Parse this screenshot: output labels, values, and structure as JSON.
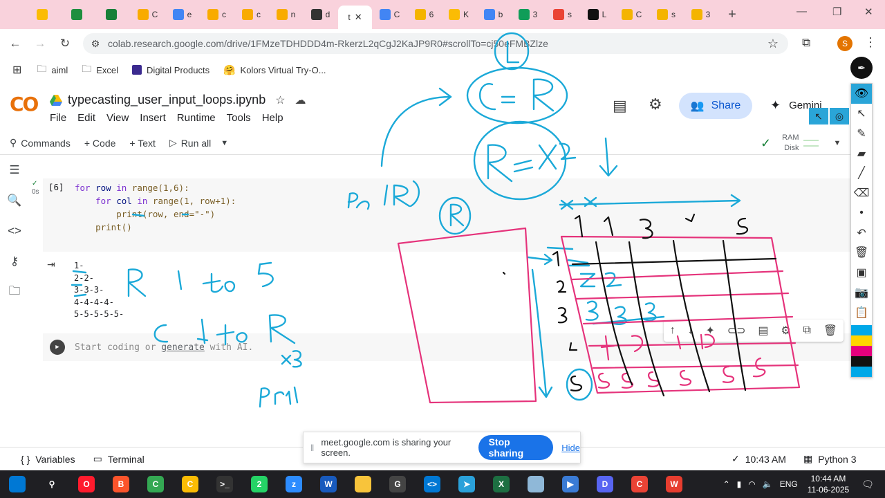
{
  "browser": {
    "tabs": [
      {
        "label": "",
        "icon": "emoji-icon",
        "color": "#fbbc04"
      },
      {
        "label": "",
        "icon": "classroom-icon",
        "color": "#1e8e3e"
      },
      {
        "label": "",
        "icon": "sheets-icon",
        "color": "#188038"
      },
      {
        "label": "C",
        "icon": "colab-icon",
        "color": "#f9ab00"
      },
      {
        "label": "e",
        "icon": "drive-icon",
        "color": "#4285f4"
      },
      {
        "label": "c",
        "icon": "colab-icon",
        "color": "#f9ab00"
      },
      {
        "label": "c",
        "icon": "colab-icon",
        "color": "#f9ab00"
      },
      {
        "label": "n",
        "icon": "colab-icon",
        "color": "#f9ab00"
      },
      {
        "label": "d",
        "icon": "github-icon",
        "color": "#333333"
      },
      {
        "label": "t",
        "icon": "none",
        "color": "#ffffff",
        "active": true
      },
      {
        "label": "C",
        "icon": "drive-icon",
        "color": "#4285f4"
      },
      {
        "label": "6",
        "icon": "slides-icon",
        "color": "#f4b400"
      },
      {
        "label": "K",
        "icon": "emoji-icon",
        "color": "#fbbc04"
      },
      {
        "label": "b",
        "icon": "google-icon",
        "color": "#4285f4"
      },
      {
        "label": "3",
        "icon": "notion-icon",
        "color": "#0f9d58"
      },
      {
        "label": "s",
        "icon": "google-icon",
        "color": "#ea4335"
      },
      {
        "label": "L",
        "icon": "openai-icon",
        "color": "#111111"
      },
      {
        "label": "C",
        "icon": "slides-icon",
        "color": "#f4b400"
      },
      {
        "label": "s",
        "icon": "slides-icon",
        "color": "#f4b400"
      },
      {
        "label": "3",
        "icon": "slides-icon",
        "color": "#f4b400"
      }
    ],
    "url": "colab.research.google.com/drive/1FMzeTDHDDD4m-RkerzL2qCgJ2KaJP9R0#scrollTo=cj50eFMBZlze",
    "profile_initial": "S",
    "bookmarks": [
      {
        "label": "aiml",
        "icon": "folder-icon"
      },
      {
        "label": "Excel",
        "icon": "folder-icon"
      },
      {
        "label": "Digital Products",
        "icon": "bookmark-icon"
      },
      {
        "label": "Kolors Virtual Try-O...",
        "icon": "hf-icon"
      }
    ]
  },
  "colab": {
    "logo": "CO",
    "filename": "typecasting_user_input_loops.ipynb",
    "menu": [
      "File",
      "Edit",
      "View",
      "Insert",
      "Runtime",
      "Tools",
      "Help"
    ],
    "share_label": "Share",
    "gemini_label": "Gemini",
    "toolbar": {
      "commands": "Commands",
      "code": "+ Code",
      "text": "+ Text",
      "run_all": "Run all",
      "ram": "RAM",
      "disk": "Disk"
    },
    "cell": {
      "exec_count": "[6]",
      "exec_time": "0s",
      "code": [
        [
          "for",
          " row ",
          "in",
          " range(1,6):"
        ],
        [
          "    for",
          " col ",
          "in",
          " range(1, row+1):"
        ],
        [
          "        print(row, end=\"-\")"
        ],
        [
          "    print()"
        ]
      ]
    },
    "output_lines": [
      "1-",
      "2-2-",
      "3-3-3-",
      "4-4-4-4-",
      "5-5-5-5-5-"
    ],
    "new_cell": {
      "prefix": "Start coding or ",
      "link": "generate",
      "suffix": " with AI."
    },
    "status": {
      "variables": "Variables",
      "terminal": "Terminal",
      "time": "10:43 AM",
      "python": "Python 3"
    }
  },
  "screen_share": {
    "message": "meet.google.com is sharing your screen.",
    "stop": "Stop sharing",
    "hide": "Hide"
  },
  "taskbar": {
    "apps": [
      {
        "name": "windows-start",
        "color": "#0078d4",
        "glyph": ""
      },
      {
        "name": "search",
        "color": "transparent",
        "glyph": "⚲"
      },
      {
        "name": "opera",
        "color": "#ff1b2d",
        "glyph": "O"
      },
      {
        "name": "brave",
        "color": "#fb542b",
        "glyph": "B"
      },
      {
        "name": "chrome-m",
        "color": "#34a853",
        "glyph": "C"
      },
      {
        "name": "chrome",
        "color": "#fbbc04",
        "glyph": "C"
      },
      {
        "name": "terminal",
        "color": "#333333",
        "glyph": ">_"
      },
      {
        "name": "whatsapp",
        "color": "#25d366",
        "glyph": "2"
      },
      {
        "name": "zoom",
        "color": "#2d8cff",
        "glyph": "z"
      },
      {
        "name": "word",
        "color": "#185abd",
        "glyph": "W"
      },
      {
        "name": "explorer",
        "color": "#f8c43b",
        "glyph": ""
      },
      {
        "name": "github",
        "color": "#444444",
        "glyph": "G"
      },
      {
        "name": "vscode",
        "color": "#0078d4",
        "glyph": "<>"
      },
      {
        "name": "telegram",
        "color": "#2aa1da",
        "glyph": "➤"
      },
      {
        "name": "excel",
        "color": "#1d6f42",
        "glyph": "X"
      },
      {
        "name": "notes",
        "color": "#8fb8d8",
        "glyph": ""
      },
      {
        "name": "recorder",
        "color": "#3a7bd5",
        "glyph": "▶"
      },
      {
        "name": "discord",
        "color": "#5865f2",
        "glyph": "D"
      },
      {
        "name": "chrome-2",
        "color": "#ea4335",
        "glyph": "C"
      },
      {
        "name": "wps",
        "color": "#e73d2f",
        "glyph": "W"
      }
    ],
    "lang": "ENG",
    "time": "10:44 AM",
    "date": "11-06-2025"
  },
  "palette": {
    "colors": [
      "#00a8e8",
      "#ffd400",
      "#e6007e",
      "#111111",
      "#00a8e8"
    ]
  }
}
